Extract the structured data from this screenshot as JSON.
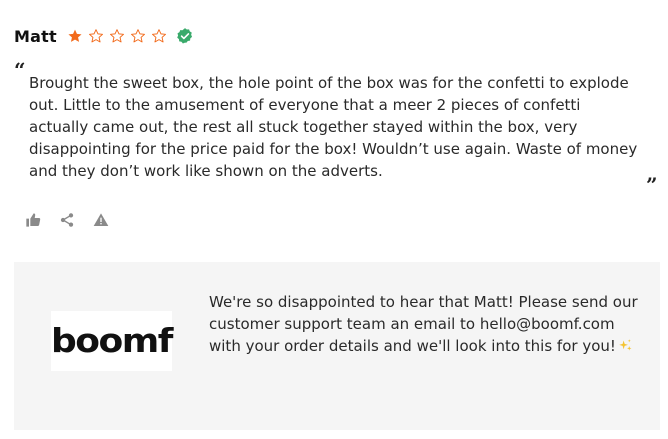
{
  "review": {
    "author": "Matt",
    "rating": 1,
    "rating_max": 5,
    "verified_icon": "verified-badge-icon",
    "text": "Brought the sweet box, the hole point of the box was for the confetti to explode out. Little to the amusement of everyone that a meer 2 pieces of confetti actually came out, the rest all stuck together stayed within the box, very disappointing for the price paid for the box! Wouldn’t use again. Waste of money and they don’t work like shown on the adverts.",
    "open_quote": "“",
    "close_quote": "”"
  },
  "actions": {
    "icons": [
      "thumbs-up-icon",
      "share-icon",
      "report-warning-icon"
    ]
  },
  "reply": {
    "logo_text": "boomf",
    "text": "We're so disappointed to hear that Matt! Please send our customer support team an email to hello@boomf.com with your order details and we'll look into this for you!",
    "sparkle_icon": "sparkle-icon"
  },
  "colors": {
    "star": "#f26a1b",
    "verified": "#3aaa6b",
    "action_icon": "#8a8a8a",
    "reply_bg": "#f5f5f5"
  }
}
